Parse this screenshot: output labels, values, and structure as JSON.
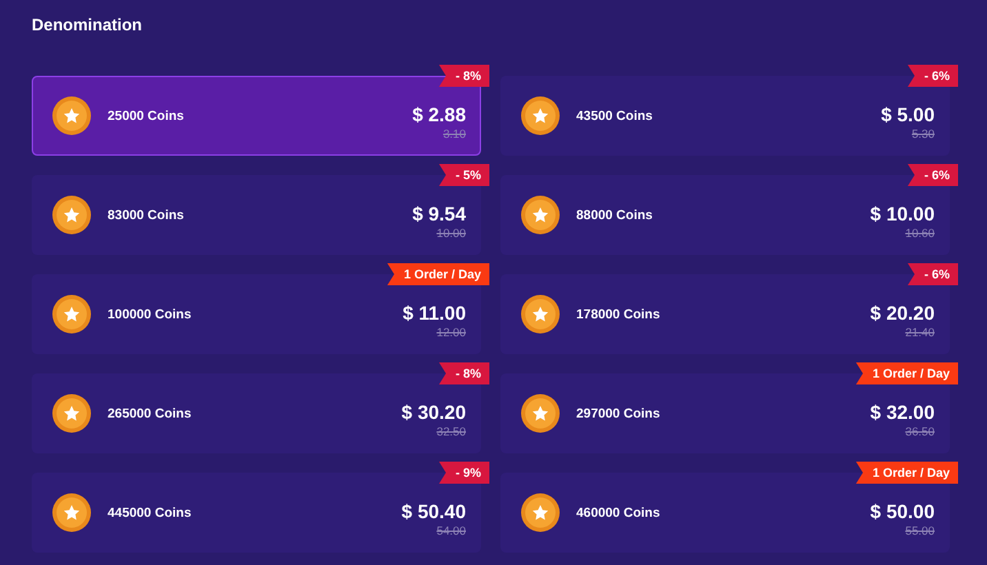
{
  "title": "Denomination",
  "items": [
    {
      "label": "25000 Coins",
      "price": "$ 2.88",
      "old_price": "3.10",
      "tag": {
        "kind": "discount",
        "text": "- 8%"
      },
      "selected": true
    },
    {
      "label": "43500 Coins",
      "price": "$ 5.00",
      "old_price": "5.30",
      "tag": {
        "kind": "discount",
        "text": "- 6%"
      },
      "selected": false
    },
    {
      "label": "83000 Coins",
      "price": "$ 9.54",
      "old_price": "10.00",
      "tag": {
        "kind": "discount",
        "text": "- 5%"
      },
      "selected": false
    },
    {
      "label": "88000 Coins",
      "price": "$ 10.00",
      "old_price": "10.60",
      "tag": {
        "kind": "discount",
        "text": "- 6%"
      },
      "selected": false
    },
    {
      "label": "100000 Coins",
      "price": "$ 11.00",
      "old_price": "12.00",
      "tag": {
        "kind": "limit",
        "text": "1 Order / Day"
      },
      "selected": false
    },
    {
      "label": "178000 Coins",
      "price": "$ 20.20",
      "old_price": "21.40",
      "tag": {
        "kind": "discount",
        "text": "- 6%"
      },
      "selected": false
    },
    {
      "label": "265000 Coins",
      "price": "$ 30.20",
      "old_price": "32.50",
      "tag": {
        "kind": "discount",
        "text": "- 8%"
      },
      "selected": false
    },
    {
      "label": "297000 Coins",
      "price": "$ 32.00",
      "old_price": "36.50",
      "tag": {
        "kind": "limit",
        "text": "1 Order / Day"
      },
      "selected": false
    },
    {
      "label": "445000 Coins",
      "price": "$ 50.40",
      "old_price": "54.00",
      "tag": {
        "kind": "discount",
        "text": "- 9%"
      },
      "selected": false
    },
    {
      "label": "460000 Coins",
      "price": "$ 50.00",
      "old_price": "55.00",
      "tag": {
        "kind": "limit",
        "text": "1 Order / Day"
      },
      "selected": false
    }
  ]
}
